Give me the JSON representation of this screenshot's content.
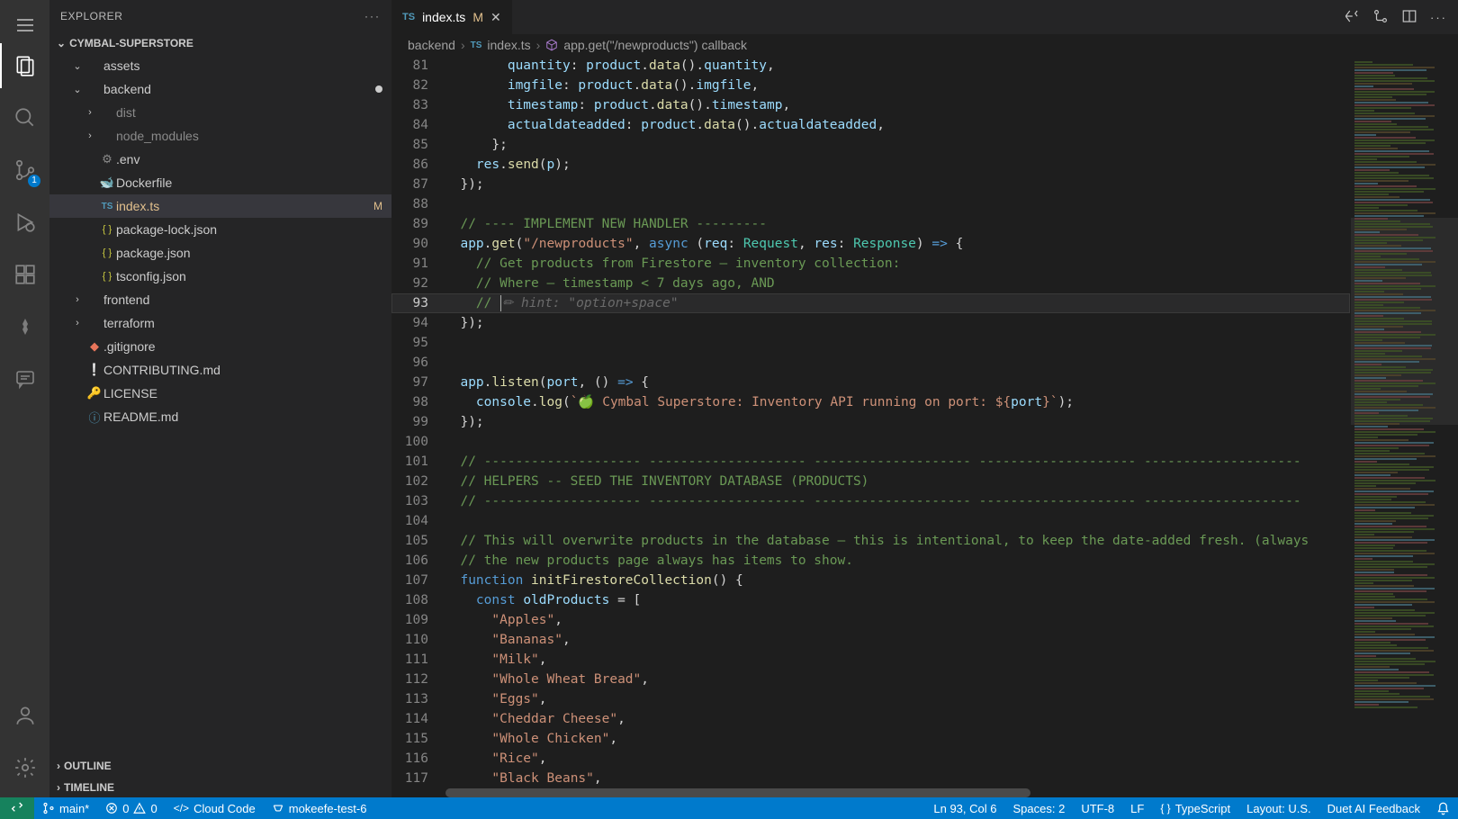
{
  "explorer_title": "EXPLORER",
  "workspace_name": "CYMBAL-SUPERSTORE",
  "outline_label": "OUTLINE",
  "timeline_label": "TIMELINE",
  "scm_badge": "1",
  "tree": [
    {
      "indent": 1,
      "chevron": "down",
      "icon": "",
      "label": "assets",
      "type": "folder"
    },
    {
      "indent": 1,
      "chevron": "down",
      "icon": "",
      "label": "backend",
      "type": "folder",
      "dirty": true
    },
    {
      "indent": 2,
      "chevron": "right",
      "icon": "",
      "label": "dist",
      "type": "folder",
      "muted": true
    },
    {
      "indent": 2,
      "chevron": "right",
      "icon": "",
      "label": "node_modules",
      "type": "folder",
      "muted": true
    },
    {
      "indent": 2,
      "chevron": "",
      "icon": "gear",
      "label": ".env",
      "type": "file"
    },
    {
      "indent": 2,
      "chevron": "",
      "icon": "docker",
      "label": "Dockerfile",
      "type": "file"
    },
    {
      "indent": 2,
      "chevron": "",
      "icon": "ts",
      "label": "index.ts",
      "type": "file",
      "status": "M",
      "active": true
    },
    {
      "indent": 2,
      "chevron": "",
      "icon": "json",
      "label": "package-lock.json",
      "type": "file"
    },
    {
      "indent": 2,
      "chevron": "",
      "icon": "json",
      "label": "package.json",
      "type": "file"
    },
    {
      "indent": 2,
      "chevron": "",
      "icon": "json",
      "label": "tsconfig.json",
      "type": "file"
    },
    {
      "indent": 1,
      "chevron": "right",
      "icon": "",
      "label": "frontend",
      "type": "folder"
    },
    {
      "indent": 1,
      "chevron": "right",
      "icon": "",
      "label": "terraform",
      "type": "folder"
    },
    {
      "indent": 1,
      "chevron": "",
      "icon": "git",
      "label": ".gitignore",
      "type": "file"
    },
    {
      "indent": 1,
      "chevron": "",
      "icon": "md1",
      "label": "CONTRIBUTING.md",
      "type": "file"
    },
    {
      "indent": 1,
      "chevron": "",
      "icon": "key",
      "label": "LICENSE",
      "type": "file"
    },
    {
      "indent": 1,
      "chevron": "",
      "icon": "info",
      "label": "README.md",
      "type": "file"
    }
  ],
  "tab": {
    "icon": "ts",
    "name": "index.ts",
    "mod": "M"
  },
  "breadcrumbs": [
    {
      "icon": "",
      "text": "backend"
    },
    {
      "icon": "ts",
      "text": "index.ts"
    },
    {
      "icon": "cube",
      "text": "app.get(\"/newproducts\") callback"
    }
  ],
  "code": [
    {
      "n": 81,
      "html": "        <span class='tok-var'>quantity</span><span class='tok-p'>: </span><span class='tok-var'>product</span><span class='tok-p'>.</span><span class='tok-fn'>data</span><span class='tok-p'>().</span><span class='tok-var'>quantity</span><span class='tok-p'>,</span>"
    },
    {
      "n": 82,
      "html": "        <span class='tok-var'>imgfile</span><span class='tok-p'>: </span><span class='tok-var'>product</span><span class='tok-p'>.</span><span class='tok-fn'>data</span><span class='tok-p'>().</span><span class='tok-var'>imgfile</span><span class='tok-p'>,</span>"
    },
    {
      "n": 83,
      "html": "        <span class='tok-var'>timestamp</span><span class='tok-p'>: </span><span class='tok-var'>product</span><span class='tok-p'>.</span><span class='tok-fn'>data</span><span class='tok-p'>().</span><span class='tok-var'>timestamp</span><span class='tok-p'>,</span>"
    },
    {
      "n": 84,
      "html": "        <span class='tok-var'>actualdateadded</span><span class='tok-p'>: </span><span class='tok-var'>product</span><span class='tok-p'>.</span><span class='tok-fn'>data</span><span class='tok-p'>().</span><span class='tok-var'>actualdateadded</span><span class='tok-p'>,</span>"
    },
    {
      "n": 85,
      "html": "      <span class='tok-p'>};</span>"
    },
    {
      "n": 86,
      "html": "    <span class='tok-var'>res</span><span class='tok-p'>.</span><span class='tok-fn'>send</span><span class='tok-p'>(</span><span class='tok-var'>p</span><span class='tok-p'>);</span>"
    },
    {
      "n": 87,
      "html": "  <span class='tok-p'>});</span>"
    },
    {
      "n": 88,
      "html": ""
    },
    {
      "n": 89,
      "html": "  <span class='tok-com'>// ---- IMPLEMENT NEW HANDLER ---------</span>"
    },
    {
      "n": 90,
      "html": "  <span class='tok-var'>app</span><span class='tok-p'>.</span><span class='tok-fn'>get</span><span class='tok-p'>(</span><span class='tok-str'>\"/newproducts\"</span><span class='tok-p'>, </span><span class='tok-key'>async</span><span class='tok-p'> (</span><span class='tok-var'>req</span><span class='tok-p'>: </span><span class='tok-type'>Request</span><span class='tok-p'>, </span><span class='tok-var'>res</span><span class='tok-p'>: </span><span class='tok-type'>Response</span><span class='tok-p'>) </span><span class='tok-key'>=&gt;</span><span class='tok-p'> {</span>"
    },
    {
      "n": 91,
      "html": "    <span class='tok-com'>// Get products from Firestore – inventory collection:</span>"
    },
    {
      "n": 92,
      "html": "    <span class='tok-com'>// Where – timestamp &lt; 7 days ago, AND</span>"
    },
    {
      "n": 93,
      "current": true,
      "html": "    <span class='tok-com'>// </span><span class='cursor'></span><span class='tok-ghost'>✏︎ hint: \"option+space\"</span>"
    },
    {
      "n": 94,
      "html": "  <span class='tok-p'>});</span>"
    },
    {
      "n": 95,
      "html": ""
    },
    {
      "n": 96,
      "html": ""
    },
    {
      "n": 97,
      "html": "  <span class='tok-var'>app</span><span class='tok-p'>.</span><span class='tok-fn'>listen</span><span class='tok-p'>(</span><span class='tok-var'>port</span><span class='tok-p'>, () </span><span class='tok-key'>=&gt;</span><span class='tok-p'> {</span>"
    },
    {
      "n": 98,
      "html": "    <span class='tok-var'>console</span><span class='tok-p'>.</span><span class='tok-fn'>log</span><span class='tok-p'>(</span><span class='tok-str'>`🍏 Cymbal Superstore: Inventory API running on port: ${</span><span class='tok-var'>port</span><span class='tok-str'>}`</span><span class='tok-p'>);</span>"
    },
    {
      "n": 99,
      "html": "  <span class='tok-p'>});</span>"
    },
    {
      "n": 100,
      "html": ""
    },
    {
      "n": 101,
      "html": "  <span class='tok-com'>// -------------------- -------------------- -------------------- -------------------- --------------------</span>"
    },
    {
      "n": 102,
      "html": "  <span class='tok-com'>// HELPERS -- SEED THE INVENTORY DATABASE (PRODUCTS)</span>"
    },
    {
      "n": 103,
      "html": "  <span class='tok-com'>// -------------------- -------------------- -------------------- -------------------- --------------------</span>"
    },
    {
      "n": 104,
      "html": ""
    },
    {
      "n": 105,
      "html": "  <span class='tok-com'>// This will overwrite products in the database – this is intentional, to keep the date-added fresh. (always</span>"
    },
    {
      "n": 106,
      "html": "  <span class='tok-com'>// the new products page always has items to show.</span>"
    },
    {
      "n": 107,
      "html": "  <span class='tok-key'>function</span><span class='tok-p'> </span><span class='tok-fn'>initFirestoreCollection</span><span class='tok-p'>() {</span>"
    },
    {
      "n": 108,
      "html": "    <span class='tok-key'>const</span><span class='tok-p'> </span><span class='tok-var'>oldProducts</span><span class='tok-p'> = [</span>"
    },
    {
      "n": 109,
      "html": "      <span class='tok-str'>\"Apples\"</span><span class='tok-p'>,</span>"
    },
    {
      "n": 110,
      "html": "      <span class='tok-str'>\"Bananas\"</span><span class='tok-p'>,</span>"
    },
    {
      "n": 111,
      "html": "      <span class='tok-str'>\"Milk\"</span><span class='tok-p'>,</span>"
    },
    {
      "n": 112,
      "html": "      <span class='tok-str'>\"Whole Wheat Bread\"</span><span class='tok-p'>,</span>"
    },
    {
      "n": 113,
      "html": "      <span class='tok-str'>\"Eggs\"</span><span class='tok-p'>,</span>"
    },
    {
      "n": 114,
      "html": "      <span class='tok-str'>\"Cheddar Cheese\"</span><span class='tok-p'>,</span>"
    },
    {
      "n": 115,
      "html": "      <span class='tok-str'>\"Whole Chicken\"</span><span class='tok-p'>,</span>"
    },
    {
      "n": 116,
      "html": "      <span class='tok-str'>\"Rice\"</span><span class='tok-p'>,</span>"
    },
    {
      "n": 117,
      "html": "      <span class='tok-str'>\"Black Beans\"</span><span class='tok-p'>,</span>"
    }
  ],
  "status": {
    "branch": "main*",
    "errors": "0",
    "warnings": "0",
    "cloud": "Cloud Code",
    "context": "mokeefe-test-6",
    "pos": "Ln 93, Col 6",
    "spaces": "Spaces: 2",
    "encoding": "UTF-8",
    "eol": "LF",
    "lang": "TypeScript",
    "layout": "Layout: U.S.",
    "feedback": "Duet AI Feedback"
  }
}
